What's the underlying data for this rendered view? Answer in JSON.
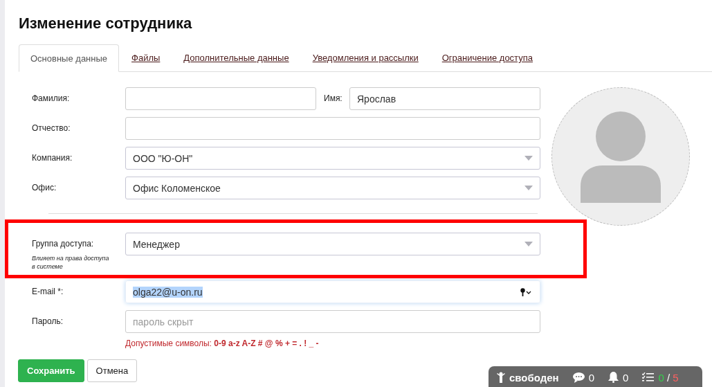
{
  "title": "Изменение сотрудника",
  "tabs": [
    {
      "label": "Основные данные",
      "selected": true
    },
    {
      "label": "Файлы",
      "selected": false
    },
    {
      "label": "Дополнительные данные",
      "selected": false
    },
    {
      "label": "Уведомления и рассылки",
      "selected": false
    },
    {
      "label": "Ограничение доступа",
      "selected": false
    }
  ],
  "form": {
    "rows": [
      {
        "label": "Фамилия:",
        "kind": "text",
        "side": {
          "label": "Имя:",
          "value": "Ярослав"
        }
      },
      {
        "label": "Отчество:",
        "kind": "text"
      },
      {
        "label": "Компания:",
        "kind": "select",
        "value": "ООО \"Ю-ОН\""
      },
      {
        "label": "Офис:",
        "kind": "select",
        "value": "Офис Коломенское",
        "divider_after": true
      },
      {
        "label": "Группа доступа:",
        "note": "Влияет на права доступа в системе",
        "kind": "select",
        "value": "Менеджер",
        "highlighted": true
      },
      {
        "label": "E-mail *:",
        "kind": "email",
        "value": "olga22@u-on.ru",
        "focused": true,
        "value_selected": true
      },
      {
        "label": "Пароль:",
        "kind": "text",
        "placeholder": "пароль скрыт",
        "hint": "Допустимые символы: **0-9 a-z A-Z # @ % + = . ! _ -**"
      }
    ]
  },
  "buttons": [
    {
      "label": "Сохранить",
      "kind": "primary"
    },
    {
      "label": "Отмена",
      "kind": "secondary"
    }
  ],
  "status_bar": {
    "status": "свободен",
    "messages": "0",
    "notifications": "0",
    "tasks_done": "0",
    "separator": "/",
    "tasks_total": "5"
  }
}
